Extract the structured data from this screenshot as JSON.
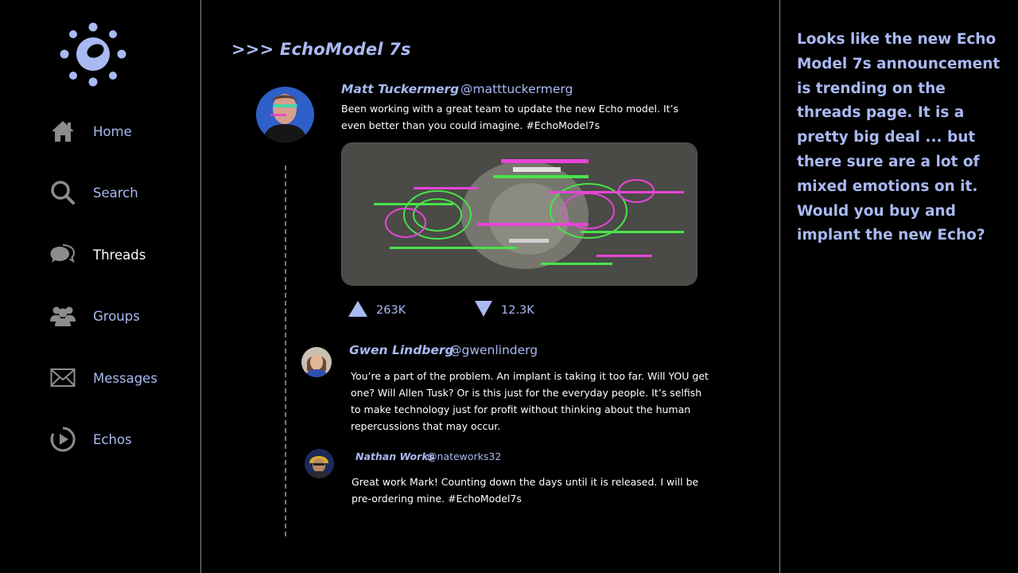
{
  "sidebar": {
    "items": [
      {
        "label": "Home",
        "icon": "home-icon",
        "active": false
      },
      {
        "label": "Search",
        "icon": "search-icon",
        "active": false
      },
      {
        "label": "Threads",
        "icon": "threads-icon",
        "active": true
      },
      {
        "label": "Groups",
        "icon": "groups-icon",
        "active": false
      },
      {
        "label": "Messages",
        "icon": "envelope-icon",
        "active": false
      },
      {
        "label": "Echos",
        "icon": "play-icon",
        "active": false
      }
    ]
  },
  "main": {
    "title": ">>> EchoModel 7s",
    "post": {
      "author": "Matt Tuckermerg",
      "handle": "@matttuckermerg",
      "text": "Been working with a great team to update the new Echo model. It’s even better than you could imagine. #EchoModel7s",
      "upvotes": "263K",
      "downvotes": "12.3K"
    },
    "replies": [
      {
        "author": "Gwen Lindberg",
        "handle": "@gwenlinderg",
        "text": "You’re a part of the problem. An implant is taking it too far. Will YOU get one? Will Allen Tusk? Or is this just for the everyday people. It’s selfish to make technology just for profit without thinking about the human repercussions that may occur."
      },
      {
        "author": "Nathan Works",
        "handle": "@nateworks32",
        "text": "Great work Mark! Counting down the days until it is released. I will be pre-ordering mine. #EchoModel7s"
      }
    ]
  },
  "right_panel": {
    "text": "Looks like the new Echo Model 7s announcement is trending on the threads page. It is a pretty big deal ... but there sure are a lot of mixed emotions on it. Would you buy and implant the new Echo?"
  },
  "colors": {
    "accent": "#a9b9f2",
    "background": "#000000",
    "icon_gray": "#8c8c8c"
  }
}
